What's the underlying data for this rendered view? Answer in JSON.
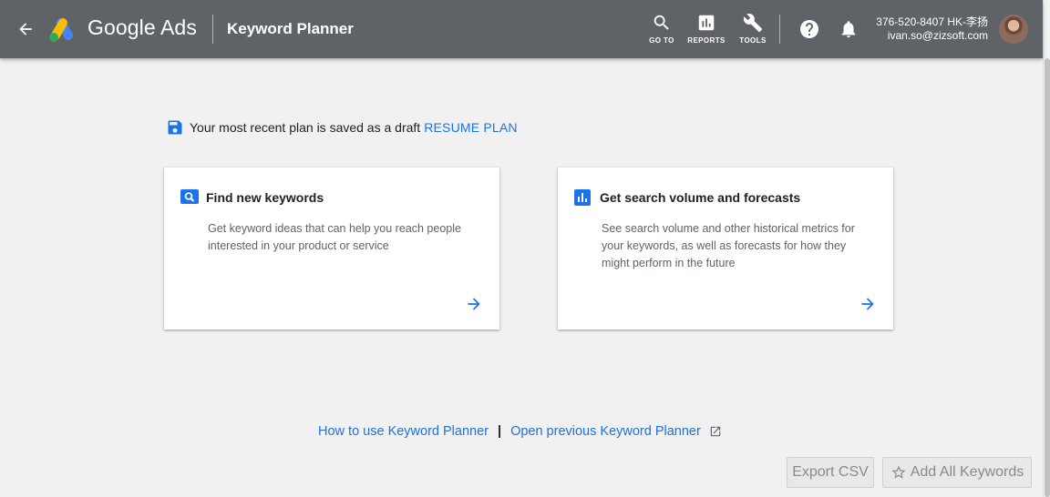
{
  "header": {
    "product_name": "Google Ads",
    "page_title": "Keyword Planner",
    "tools": [
      {
        "label": "GO TO",
        "icon": "search-icon"
      },
      {
        "label": "REPORTS",
        "icon": "bar-chart-icon"
      },
      {
        "label": "TOOLS",
        "icon": "wrench-icon"
      }
    ],
    "account_id": "376-520-8407 HK-李扬",
    "account_email": "ivan.so@zizsoft.com"
  },
  "draft": {
    "message": "Your most recent plan is saved as a draft",
    "resume_label": "RESUME PLAN"
  },
  "cards": [
    {
      "title": "Find new keywords",
      "description": "Get keyword ideas that can help you reach people interested in your product or service",
      "icon": "search-box-icon"
    },
    {
      "title": "Get search volume and forecasts",
      "description": "See search volume and other historical metrics for your keywords, as well as forecasts for how they might perform in the future",
      "icon": "chart-box-icon"
    }
  ],
  "links": {
    "how_to": "How to use Keyword Planner",
    "separator": "|",
    "open_previous": "Open previous Keyword Planner"
  },
  "buttons": {
    "export_csv": "Export CSV",
    "add_all_keywords": "Add All Keywords"
  },
  "colors": {
    "header_bg": "#5f6368",
    "accent_blue": "#1a73e8",
    "page_bg": "#f1f1f1"
  }
}
